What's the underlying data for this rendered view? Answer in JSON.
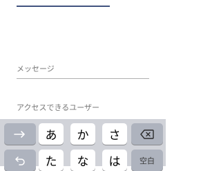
{
  "form": {
    "message_placeholder": "メッセージ",
    "access_placeholder": "アクセスできるユーザー"
  },
  "keyboard": {
    "row1": {
      "left_icon": "arrow-right-icon",
      "keys": [
        "あ",
        "か",
        "さ"
      ],
      "right_icon": "delete-icon"
    },
    "row2": {
      "left_icon": "undo-icon",
      "keys": [
        "た",
        "な",
        "は"
      ],
      "space_label": "空白"
    }
  },
  "colors": {
    "keyboard_background": "#d1d3d9",
    "function_key": "#aeb3be",
    "character_key": "#ffffff",
    "active_field_underline": "#41537e"
  }
}
